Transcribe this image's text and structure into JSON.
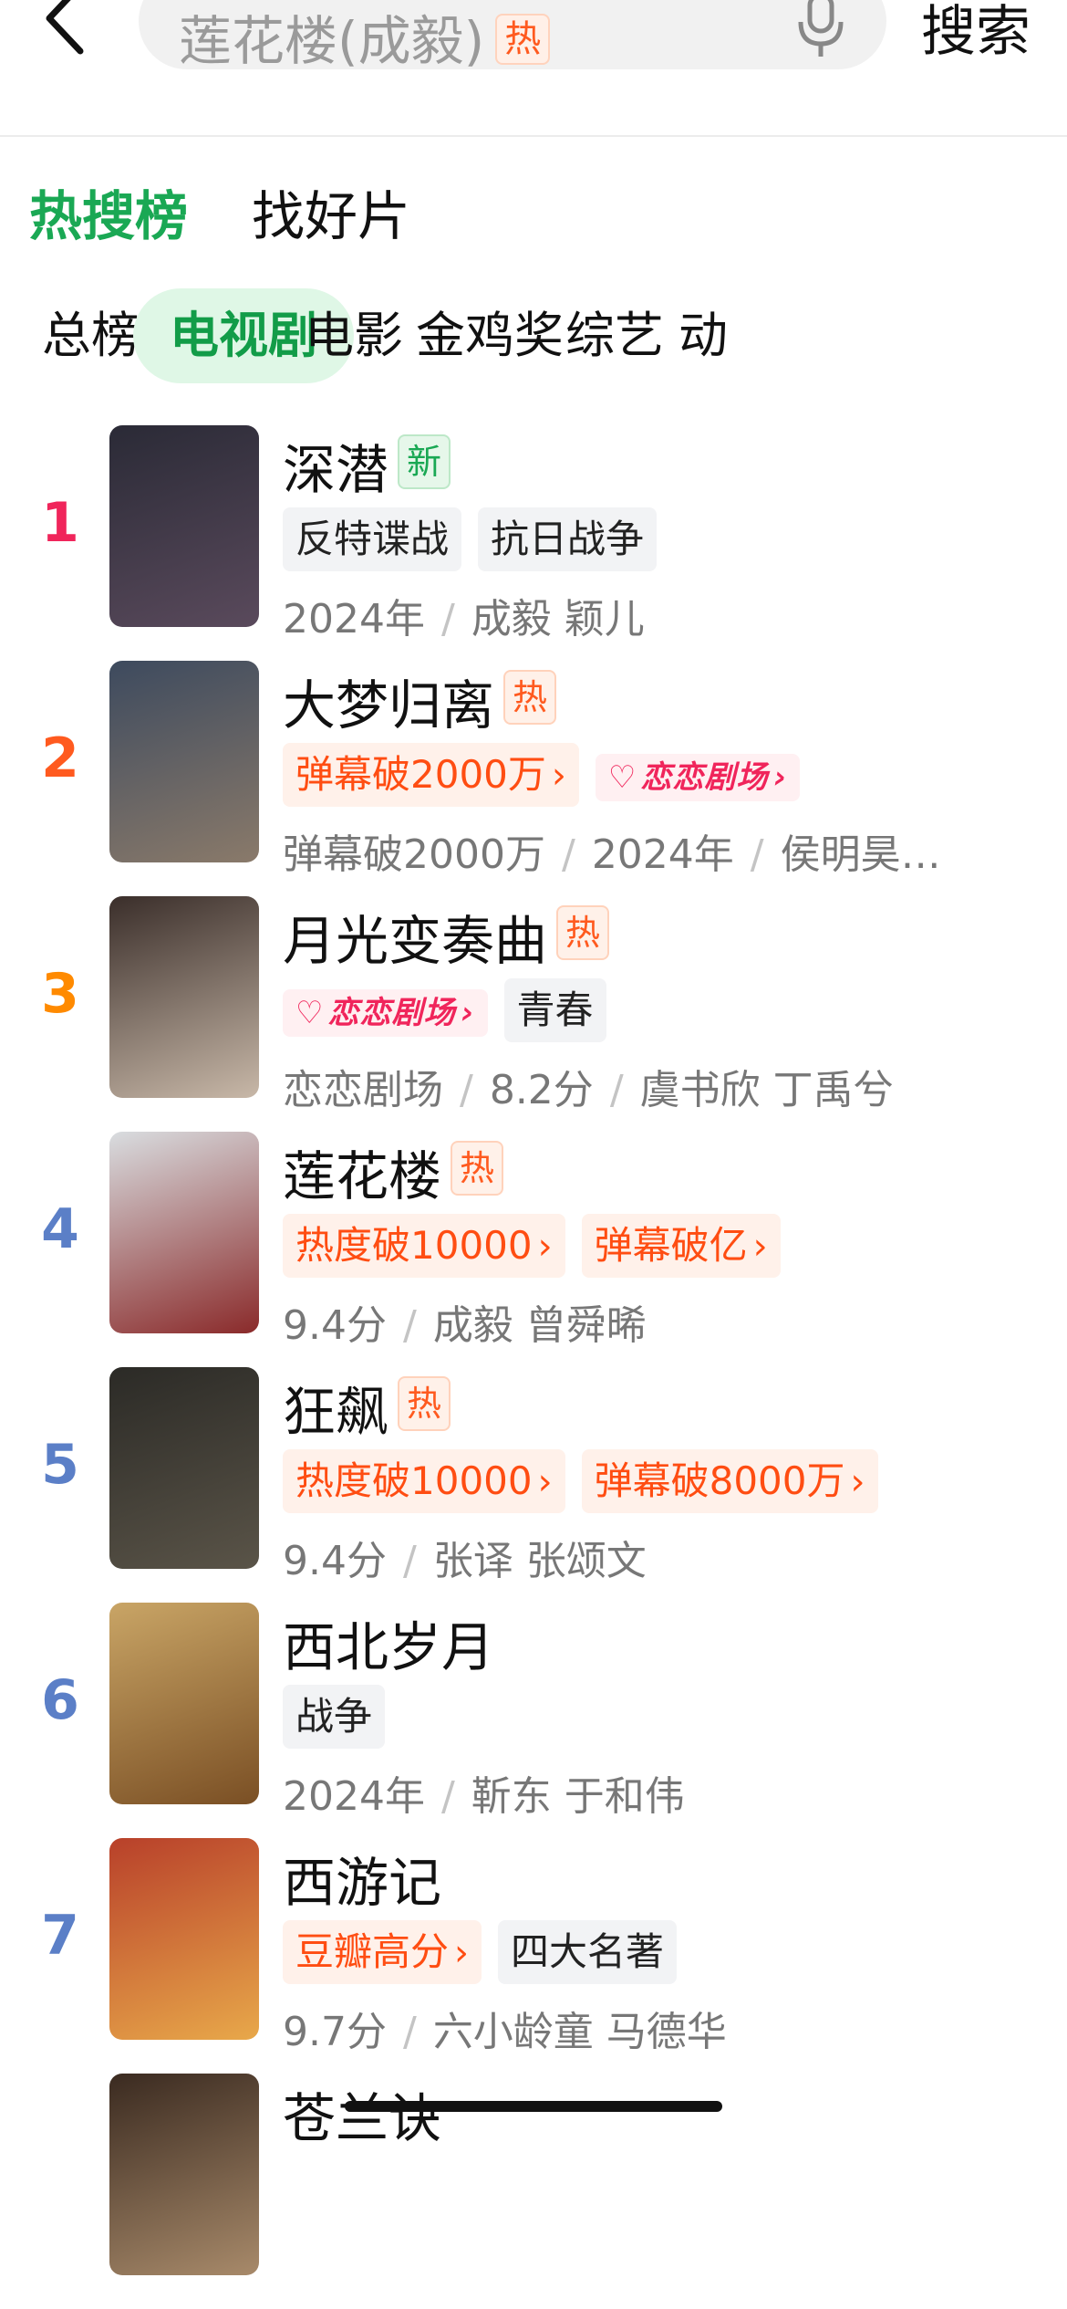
{
  "search": {
    "query": "莲花楼",
    "query_hint": "(成毅)",
    "hot_label": "热",
    "button_label": "搜索"
  },
  "main_tabs": [
    {
      "label": "热搜榜",
      "active": true
    },
    {
      "label": "找好片",
      "active": false
    }
  ],
  "categories": [
    {
      "label": "总榜",
      "active": false
    },
    {
      "label": "电视剧",
      "active": true
    },
    {
      "label": "电影",
      "active": false
    },
    {
      "label": "金鸡奖",
      "active": false
    },
    {
      "label": "综艺",
      "active": false
    },
    {
      "label": "动",
      "active": false
    }
  ],
  "rank_colors": [
    "#f0255b",
    "#ff5a1f",
    "#ff8a00",
    "#5b7fc7",
    "#5b7fc7",
    "#5b7fc7",
    "#5b7fc7"
  ],
  "items": [
    {
      "rank": "1",
      "title": "深潜",
      "badge": "新",
      "badge_type": "new",
      "tags": [
        {
          "text": "反特谍战",
          "style": "gray"
        },
        {
          "text": "抗日战争",
          "style": "gray"
        }
      ],
      "meta": [
        "2024年",
        "成毅 颖儿"
      ],
      "poster_colors": [
        "#2a2a36",
        "#5a4a5c"
      ]
    },
    {
      "rank": "2",
      "title": "大梦归离",
      "badge": "热",
      "badge_type": "hot",
      "tags": [
        {
          "text": "弹幕破2000万",
          "style": "orange"
        },
        {
          "text": "恋恋剧场",
          "style": "brand"
        }
      ],
      "meta": [
        "弹幕破2000万",
        "2024年",
        "侯明昊…"
      ],
      "poster_colors": [
        "#3d4a5e",
        "#8a7a6a"
      ]
    },
    {
      "rank": "3",
      "title": "月光变奏曲",
      "badge": "热",
      "badge_type": "hot",
      "tags": [
        {
          "text": "恋恋剧场",
          "style": "brand"
        },
        {
          "text": "青春",
          "style": "gray"
        }
      ],
      "meta": [
        "恋恋剧场",
        "8.2分",
        "虞书欣 丁禹兮"
      ],
      "poster_colors": [
        "#3a2e2a",
        "#c8b8a8"
      ]
    },
    {
      "rank": "4",
      "title": "莲花楼",
      "badge": "热",
      "badge_type": "hot",
      "tags": [
        {
          "text": "热度破10000",
          "style": "orange"
        },
        {
          "text": "弹幕破亿",
          "style": "orange"
        }
      ],
      "meta": [
        "9.4分",
        "成毅 曾舜晞"
      ],
      "poster_colors": [
        "#d9dde0",
        "#8a2a2a"
      ]
    },
    {
      "rank": "5",
      "title": "狂飙",
      "badge": "热",
      "badge_type": "hot",
      "tags": [
        {
          "text": "热度破10000",
          "style": "orange"
        },
        {
          "text": "弹幕破8000万",
          "style": "orange"
        }
      ],
      "meta": [
        "9.4分",
        "张译 张颂文"
      ],
      "poster_colors": [
        "#2b2a26",
        "#5a5448"
      ]
    },
    {
      "rank": "6",
      "title": "西北岁月",
      "badge": "",
      "badge_type": "",
      "tags": [
        {
          "text": "战争",
          "style": "gray"
        }
      ],
      "meta": [
        "2024年",
        "靳东 于和伟"
      ],
      "poster_colors": [
        "#c9a566",
        "#7a4f24"
      ]
    },
    {
      "rank": "7",
      "title": "西游记",
      "badge": "",
      "badge_type": "",
      "tags": [
        {
          "text": "豆瓣高分",
          "style": "orange"
        },
        {
          "text": "四大名著",
          "style": "gray"
        }
      ],
      "meta": [
        "9.7分",
        "六小龄童 马德华"
      ],
      "poster_colors": [
        "#b8402a",
        "#e8a84a"
      ]
    },
    {
      "rank": "",
      "title": "苍兰诀",
      "badge": "",
      "badge_type": "",
      "tags": [],
      "meta": [],
      "poster_colors": [
        "#3a2a20",
        "#a88a6a"
      ]
    }
  ]
}
